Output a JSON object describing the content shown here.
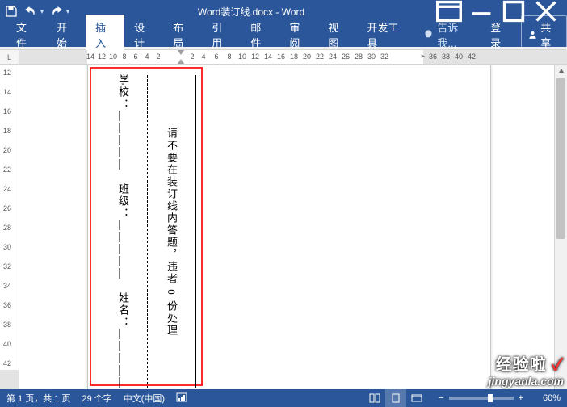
{
  "titlebar": {
    "title": "Word装订线.docx - Word"
  },
  "ribbon": {
    "tabs": {
      "file": "文件",
      "home": "开始",
      "insert": "插入",
      "design": "设计",
      "layout": "布局",
      "references": "引用",
      "mailings": "邮件",
      "review": "审阅",
      "view": "视图",
      "developer": "开发工具"
    },
    "tell_me": "告诉我...",
    "login": "登录",
    "share": "共享"
  },
  "h_ruler": {
    "left_ticks": [
      "14",
      "12",
      "10",
      "8",
      "6",
      "4",
      "2"
    ],
    "right_ticks": [
      "2",
      "4",
      "6",
      "8",
      "10",
      "12",
      "14",
      "16",
      "18",
      "20",
      "22",
      "24",
      "26",
      "28",
      "30",
      "32"
    ],
    "far_ticks": [
      "36",
      "38",
      "40",
      "42"
    ]
  },
  "v_ruler": {
    "ticks": [
      "12",
      "14",
      "16",
      "18",
      "20",
      "22",
      "24",
      "26",
      "28",
      "30",
      "32",
      "34",
      "36",
      "38",
      "40",
      "42"
    ]
  },
  "gutter": {
    "line1": "学校：＿＿＿＿＿　班级：＿＿＿＿＿　姓名：＿＿＿＿＿",
    "line2": "请不要在装订线内答题，违者 0 份处理"
  },
  "statusbar": {
    "page": "第 1 页，共 1 页",
    "words": "29 个字",
    "lang": "中文(中国)",
    "zoom": "60%"
  },
  "watermark": {
    "brand_cn": "经验啦",
    "brand_url": "jingyanla.com"
  },
  "ruler_corner": "L"
}
